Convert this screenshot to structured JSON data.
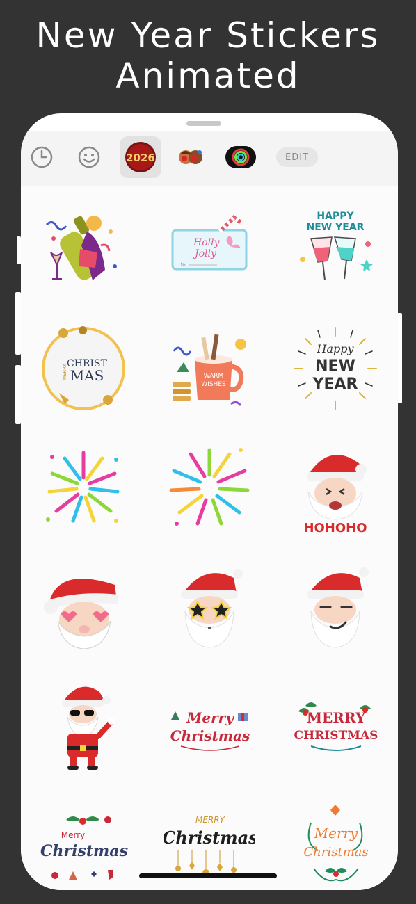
{
  "headline": {
    "line1": "New Year Stickers",
    "line2": "Animated"
  },
  "tabbar": {
    "tabs": [
      {
        "name": "recents-tab",
        "icon": "clock-icon"
      },
      {
        "name": "emoji-tab",
        "icon": "smiley-icon"
      },
      {
        "name": "year-2026-tab",
        "icon": "year-2026-icon",
        "label": "2026",
        "selected": true
      },
      {
        "name": "characters-tab",
        "icon": "characters-icon"
      },
      {
        "name": "rings-tab",
        "icon": "rings-icon"
      }
    ],
    "edit_label": "EDIT"
  },
  "stickers": {
    "r1c2": {
      "line1": "Holly",
      "line2": "Jolly",
      "to": "to:"
    },
    "r1c3": {
      "line1": "HAPPY",
      "line2": "NEW YEAR"
    },
    "r2c1": {
      "line1": "CHRIST",
      "line2": "MAS",
      "side": "MERRY"
    },
    "r2c2": {
      "line1": "WARM",
      "line2": "WISHES"
    },
    "r2c3": {
      "line1": "Happy",
      "line2": "NEW",
      "line3": "YEAR"
    },
    "r3c3": {
      "caption": "HOHOHO"
    },
    "r5c2": {
      "line1": "Merry",
      "line2": "Christmas"
    },
    "r5c3": {
      "line1": "MERRY",
      "line2": "CHRISTMAS"
    },
    "r6c1": {
      "line1": "Merry",
      "line2": "Christmas"
    },
    "r6c2": {
      "line1": "MERRY",
      "line2": "Christmas"
    },
    "r6c3": {
      "line1": "Merry",
      "line2": "Christmas"
    }
  },
  "colors": {
    "background": "#333333",
    "santa_red": "#d92b2b",
    "accent_teal": "#1e8c96"
  }
}
